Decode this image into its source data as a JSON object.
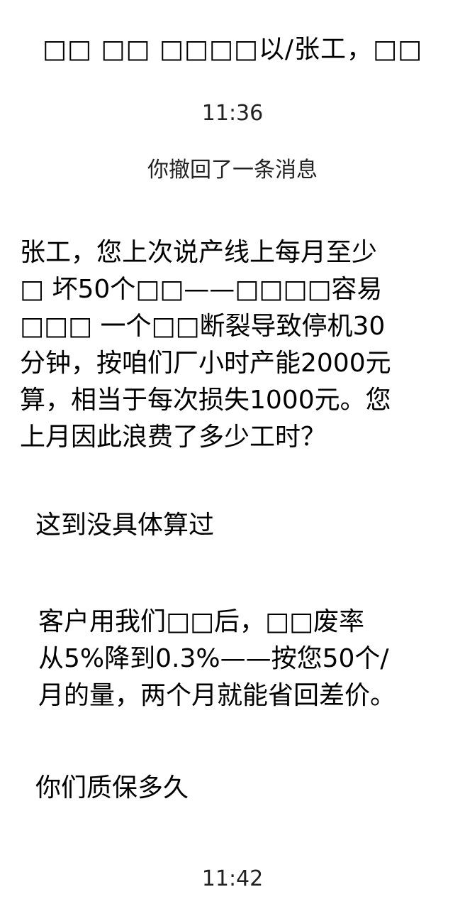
{
  "header": {
    "title": "□□ □□ □□□□以/张工，□□"
  },
  "chat": {
    "timestamp_top": "11:36",
    "recall_notice": "你撤回了一条消息",
    "messages": [
      {
        "text": "张工，您上次说产线上每月至少\n□ 坏50个□□——□□□□容易\n□□□ 一个□□断裂导致停机30\n分钟，按咱们厂小时产能2000元\n算，相当于每次损失1000元。您\n上月因此浪费了多少工时？"
      },
      {
        "text": "这到没具体算过"
      },
      {
        "text": "客户用我们□□后，□□废率\n从5%降到0.3%——按您50个/\n月的量，两个月就能省回差价。"
      },
      {
        "text": "你们质保多久"
      }
    ],
    "timestamp_bottom": "11:42"
  }
}
